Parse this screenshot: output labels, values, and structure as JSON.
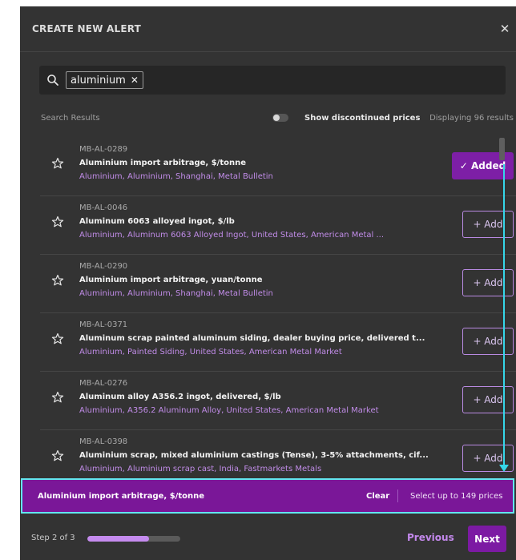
{
  "modal": {
    "title": "CREATE NEW ALERT",
    "close_glyph": "✕"
  },
  "search": {
    "query_chip": "aluminium",
    "chip_remove_glyph": "✕"
  },
  "results": {
    "label": "Search Results",
    "toggle_label": "Show discontinued prices",
    "toggle_on": false,
    "displaying": "Displaying 96 results"
  },
  "items": [
    {
      "code": "MB-AL-0289",
      "name": "Aluminium import arbitrage, $/tonne",
      "tags": "Aluminium, Aluminium, Shanghai, Metal Bulletin",
      "button": "✓ Added",
      "added": true
    },
    {
      "code": "MB-AL-0046",
      "name": "Aluminum 6063 alloyed ingot, $/lb",
      "tags": "Aluminium, Aluminum 6063 Alloyed Ingot, United States, American Metal ...",
      "button": "+ Add",
      "added": false
    },
    {
      "code": "MB-AL-0290",
      "name": "Aluminium import arbitrage, yuan/tonne",
      "tags": "Aluminium, Aluminium, Shanghai, Metal Bulletin",
      "button": "+ Add",
      "added": false
    },
    {
      "code": "MB-AL-0371",
      "name": "Aluminum scrap painted aluminum siding, dealer buying price, delivered t...",
      "tags": "Aluminium, Painted Siding, United States, American Metal Market",
      "button": "+ Add",
      "added": false
    },
    {
      "code": "MB-AL-0276",
      "name": "Aluminum alloy A356.2 ingot, delivered, $/lb",
      "tags": "Aluminium, A356.2 Aluminum Alloy, United States, American Metal Market",
      "button": "+ Add",
      "added": false
    },
    {
      "code": "MB-AL-0398",
      "name": "Aluminium scrap, mixed aluminium castings (Tense), 3-5% attachments, cif...",
      "tags": "Aluminium, Aluminium scrap cast, India, Fastmarkets Metals",
      "button": "+ Add",
      "added": false
    }
  ],
  "selection": {
    "selected_name": "Aluminium import arbitrage, $/tonne",
    "clear_label": "Clear",
    "limit_text": "Select up to 149 prices"
  },
  "footer": {
    "step_text": "Step 2 of 3",
    "progress": 0.66,
    "previous_label": "Previous",
    "next_label": "Next"
  },
  "colors": {
    "accent": "#7d1fa6",
    "tag": "#c18ce8",
    "highlight": "#35d6e8",
    "background": "#333333"
  }
}
